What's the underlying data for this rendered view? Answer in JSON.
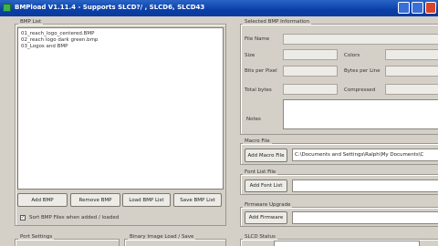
{
  "window": {
    "title": "BMPload V1.11.4 - Supports SLCD?/ , SLCD6, SLCD43",
    "icon": "app-icon"
  },
  "bmp_list": {
    "label": "BMP List",
    "items": [
      "01_reach_logo_centered.BMP",
      "02_reach logo dark green.bmp",
      "03_Logos and BMP"
    ],
    "buttons": {
      "add": "Add BMP",
      "remove": "Remove BMP",
      "load": "Load BMP List",
      "save": "Save BMP List"
    },
    "sort_checkbox": {
      "label": "Sort BMP Files when added / loaded",
      "checked": true
    }
  },
  "selected_info": {
    "label": "Selected BMP Information",
    "file_name_label": "File Name",
    "size_label": "Size",
    "colors_label": "Colors",
    "bits_per_pixel_label": "Bits per Pixel",
    "bytes_per_line_label": "Bytes per Line",
    "total_bytes_label": "Total bytes",
    "compressed_label": "Compressed",
    "notes_label": "Notes"
  },
  "macro_file": {
    "label": "Macro File",
    "button": "Add Macro File",
    "path": "C:\\Documents and Settings\\Ralph\\My Documents\\C"
  },
  "font_list_file": {
    "label": "Font List File",
    "button": "Add Font List"
  },
  "firmware_upgrade": {
    "label": "Firmware Upgrade",
    "button": "Add Firmware"
  },
  "bottom_groups": {
    "port_settings": "Port Settings",
    "binary_image": "Binary Image Load / Save",
    "slcd_status": "SLCD Status"
  }
}
